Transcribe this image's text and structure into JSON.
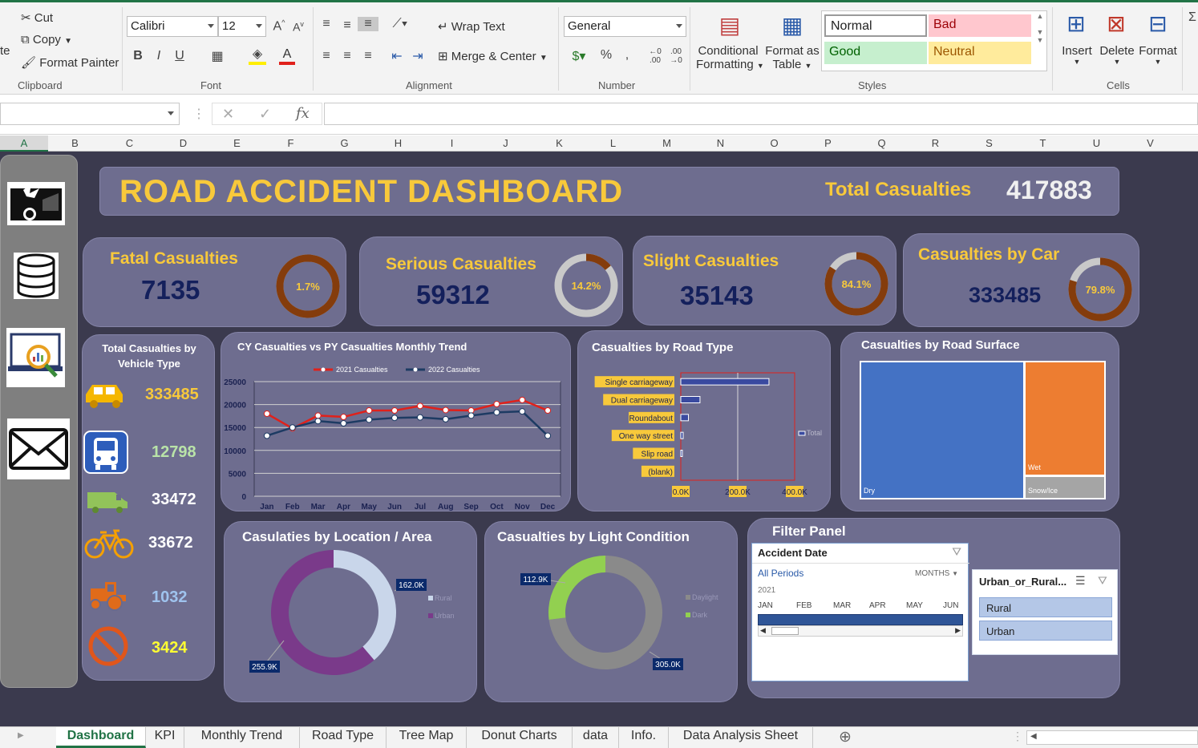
{
  "ribbon": {
    "clipboard": {
      "cut": "Cut",
      "copy": "Copy",
      "format_painter": "Format Painter",
      "paste_partial": "te",
      "label": "Clipboard"
    },
    "font": {
      "name": "Calibri",
      "size": "12",
      "label": "Font"
    },
    "alignment": {
      "wrap_text": "Wrap Text",
      "merge_center": "Merge & Center",
      "label": "Alignment"
    },
    "number": {
      "format": "General",
      "label": "Number"
    },
    "styles": {
      "conditional": "Conditional",
      "formatting": "Formatting",
      "format_as": "Format as",
      "table": "Table",
      "normal": "Normal",
      "bad": "Bad",
      "good": "Good",
      "neutral": "Neutral",
      "label": "Styles"
    },
    "cells": {
      "insert": "Insert",
      "delete": "Delete",
      "format": "Format",
      "label": "Cells"
    }
  },
  "columns": [
    "A",
    "B",
    "C",
    "D",
    "E",
    "F",
    "G",
    "H",
    "I",
    "J",
    "K",
    "L",
    "M",
    "N",
    "O",
    "P",
    "Q",
    "R",
    "S",
    "T",
    "U",
    "V"
  ],
  "dashboard": {
    "title": "ROAD ACCIDENT DASHBOARD",
    "total_label": "Total Casualties",
    "total_value": "417883",
    "kpis": [
      {
        "label": "Fatal Casualties",
        "value": "7135",
        "pct": "1.7%",
        "fraction": 0.017
      },
      {
        "label": "Serious Casualties",
        "value": "59312",
        "pct": "14.2%",
        "fraction": 0.142
      },
      {
        "label": "Slight Casualties",
        "value": "35143",
        "pct": "84.1%",
        "fraction": 0.841
      },
      {
        "label": "Casualties by Car",
        "value": "333485",
        "pct": "79.8%",
        "fraction": 0.798
      }
    ],
    "vehicle_panel": {
      "title_line1": "Total Casualties by",
      "title_line2": "Vehicle Type",
      "items": [
        {
          "icon": "car-icon",
          "value": "333485",
          "color": "#f8c93b"
        },
        {
          "icon": "bus-icon",
          "value": "12798",
          "color": "#b9e3a8"
        },
        {
          "icon": "van-icon",
          "value": "33472",
          "color": "#ffffff"
        },
        {
          "icon": "bicycle-icon",
          "value": "33672",
          "color": "#ffffff"
        },
        {
          "icon": "tractor-icon",
          "value": "1032",
          "color": "#9fc3ee"
        },
        {
          "icon": "no-entry-icon",
          "value": "3424",
          "color": "#ffff33"
        }
      ]
    },
    "trend_title": "CY Casualties vs PY Casualties Monthly Trend",
    "road_type_title": "Casualties by Road Type",
    "road_surface_title": "Casualties by Road Surface",
    "location_title": "Casulaties by Location / Area",
    "light_title": "Casualties by Light Condition",
    "filter_title": "Filter Panel",
    "slicer_date": {
      "title": "Accident Date",
      "all_periods": "All Periods",
      "months_label": "MONTHS",
      "year": "2021",
      "months": [
        "JAN",
        "FEB",
        "MAR",
        "APR",
        "MAY",
        "JUN"
      ]
    },
    "slicer_area": {
      "title": "Urban_or_Rural...",
      "options": [
        "Rural",
        "Urban"
      ]
    }
  },
  "chart_data": [
    {
      "type": "line",
      "title": "CY Casualties vs PY Casualties Monthly Trend",
      "categories": [
        "Jan",
        "Feb",
        "Mar",
        "Apr",
        "May",
        "Jun",
        "Jul",
        "Aug",
        "Sep",
        "Oct",
        "Nov",
        "Dec"
      ],
      "series": [
        {
          "name": "2021 Casualties",
          "color": "#e0211b",
          "values": [
            18000,
            14800,
            17600,
            17300,
            18700,
            18700,
            19700,
            18800,
            18700,
            20100,
            21000,
            18700
          ]
        },
        {
          "name": "2022 Casualties",
          "color": "#1d3b63",
          "values": [
            13200,
            15000,
            16400,
            15900,
            16700,
            17100,
            17200,
            16800,
            17600,
            18300,
            18500,
            13200
          ]
        }
      ],
      "ylim": [
        0,
        25000
      ],
      "yticks": [
        "0",
        "5000",
        "10000",
        "15000",
        "20000",
        "25000"
      ],
      "grid": true,
      "legend": "top"
    },
    {
      "type": "bar",
      "title": "Casualties by Road Type",
      "categories": [
        "Single carriageway",
        "Dual carriageway",
        "Roundabout",
        "One way street",
        "Slip road",
        "(blank)"
      ],
      "values": [
        309700,
        67400,
        26800,
        8400,
        5600,
        0
      ],
      "xlim": [
        0,
        400000
      ],
      "xticks": [
        "0.0K",
        "200.0K",
        "400.0K"
      ],
      "legend_label": "Total"
    },
    {
      "type": "heatmap",
      "title": "Casualties by Road Surface",
      "categories": [
        "Dry",
        "Wet",
        "Snow/Ice"
      ],
      "colors": [
        "#4472c4",
        "#ed7d31",
        "#a5a5a5"
      ]
    },
    {
      "type": "pie",
      "title": "Casulaties by Location / Area",
      "categories": [
        "Rural",
        "Urban"
      ],
      "values": [
        162000,
        255900
      ],
      "labels": [
        "162.0K",
        "255.9K"
      ],
      "colors": [
        "#c9d6ea",
        "#7a3a8a"
      ]
    },
    {
      "type": "pie",
      "title": "Casualties by Light Condition",
      "categories": [
        "Daylight",
        "Dark"
      ],
      "values": [
        305000,
        112900
      ],
      "labels": [
        "305.0K",
        "112.9K"
      ],
      "colors": [
        "#8a8a8a",
        "#92d050"
      ]
    }
  ],
  "sheet_tabs": [
    "Dashboard",
    "KPI",
    "Monthly Trend",
    "Road Type",
    "Tree Map",
    "Donut Charts",
    "data",
    "Info.",
    "Data Analysis Sheet"
  ]
}
